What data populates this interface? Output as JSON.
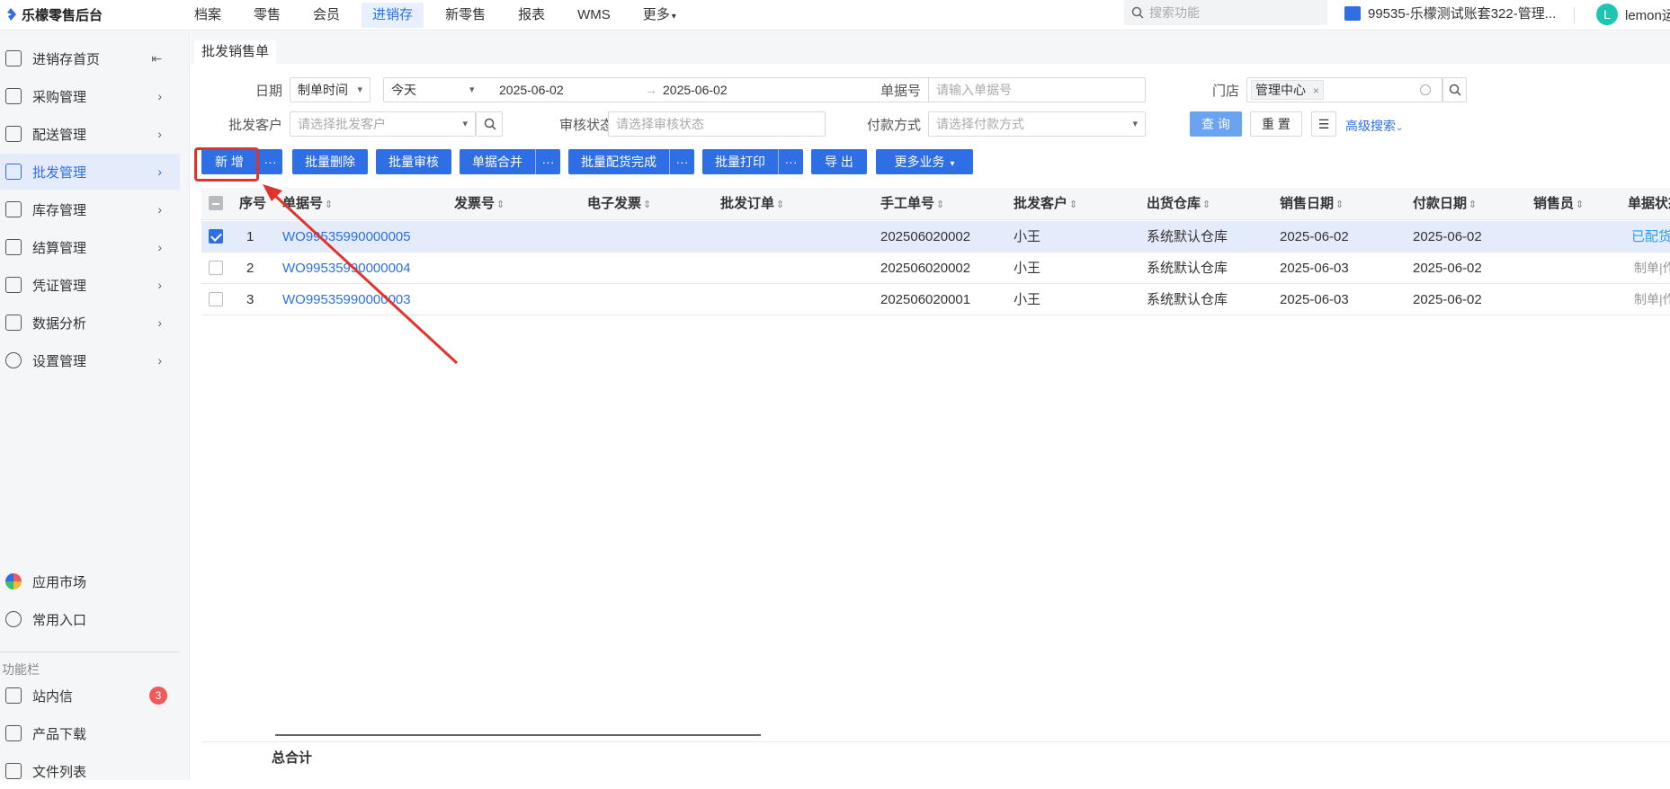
{
  "app": {
    "logo_text": "乐檬零售后台"
  },
  "topnav": [
    "档案",
    "零售",
    "会员",
    "进销存",
    "新零售",
    "报表",
    "WMS",
    "更多"
  ],
  "topnav_active": "进销存",
  "search": {
    "placeholder": "搜索功能"
  },
  "account": {
    "name": "99535-乐檬测试账套322-管理..."
  },
  "user": {
    "initial": "L",
    "name": "lemon运"
  },
  "sidebar": {
    "items": [
      "进销存首页",
      "采购管理",
      "配送管理",
      "批发管理",
      "库存管理",
      "结算管理",
      "凭证管理",
      "数据分析",
      "设置管理"
    ],
    "active": "批发管理",
    "bottom_items": [
      "应用市场",
      "常用入口"
    ],
    "section_title": "功能栏",
    "func_items": [
      "站内信",
      "产品下载",
      "文件列表"
    ],
    "message_badge": "3"
  },
  "tab": {
    "title": "批发销售单"
  },
  "filters": {
    "date_label": "日期",
    "date_type": "制单时间",
    "date_range": "今天",
    "date_start": "2025-06-02",
    "date_end": "2025-06-02",
    "doc_no_label": "单据号",
    "doc_no_placeholder": "请输入单据号",
    "store_label": "门店",
    "store_tag": "管理中心",
    "customer_label": "批发客户",
    "customer_placeholder": "请选择批发客户",
    "audit_label": "审核状态",
    "audit_placeholder": "请选择审核状态",
    "pay_label": "付款方式",
    "pay_placeholder": "请选择付款方式",
    "query_btn": "查 询",
    "reset_btn": "重 置",
    "advanced": "高级搜索"
  },
  "toolbar": {
    "add": "新 增",
    "batch_delete": "批量删除",
    "batch_audit": "批量审核",
    "merge": "单据合并",
    "batch_delivery": "批量配货完成",
    "batch_print": "批量打印",
    "export": "导 出",
    "more_business": "更多业务",
    "more_dots": "···"
  },
  "table": {
    "columns": [
      "序号",
      "单据号",
      "发票号",
      "电子发票",
      "批发订单",
      "手工单号",
      "批发客户",
      "出货仓库",
      "销售日期",
      "付款日期",
      "销售员",
      "单据状态"
    ],
    "rows": [
      {
        "checked": true,
        "seq": "1",
        "doc_no": "WO99535990000005",
        "manual_no": "202506020002",
        "customer": "小王",
        "warehouse": "系统默认仓库",
        "sale_date": "2025-06-02",
        "pay_date": "2025-06-02",
        "status": "已配货"
      },
      {
        "checked": false,
        "seq": "2",
        "doc_no": "WO99535990000004",
        "manual_no": "202506020002",
        "customer": "小王",
        "warehouse": "系统默认仓库",
        "sale_date": "2025-06-03",
        "pay_date": "2025-06-02",
        "status": "制单|作废"
      },
      {
        "checked": false,
        "seq": "3",
        "doc_no": "WO99535990000003",
        "manual_no": "202506020001",
        "customer": "小王",
        "warehouse": "系统默认仓库",
        "sale_date": "2025-06-03",
        "pay_date": "2025-06-02",
        "status": "制单|作废"
      }
    ],
    "total_label": "总合计"
  },
  "colors": {
    "primary": "#2f6fe6",
    "annotation": "#e0332d",
    "badge": "#f25a5a"
  }
}
